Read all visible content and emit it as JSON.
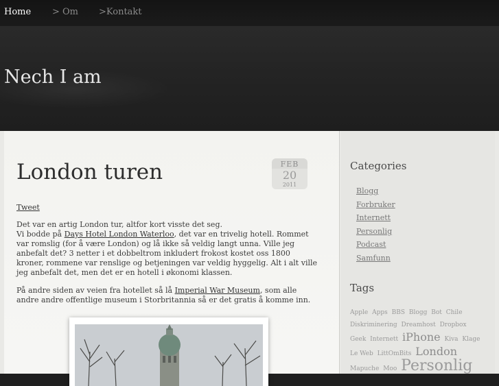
{
  "nav": {
    "home": "Home",
    "om": "> Om",
    "kontakt": ">Kontakt"
  },
  "header": {
    "site_title": "Nech I am"
  },
  "post": {
    "title": "London turen",
    "date": {
      "month": "FEB",
      "day": "20",
      "year": "2011"
    },
    "tweet_label": "Tweet",
    "p1_line1": "Det var en artig London tur, altfor kort visste det seg.",
    "p1_line2_pre": "Vi bodde på ",
    "p1_link": "Days Hotel London Waterloo",
    "p1_line2_post": ", det var en trivelig hotell. Rommet var romslig (for å være London) og lå ikke så veldig langt unna. Ville jeg anbefalt det? 3 netter i et dobbeltrom inkludert frokost kostet oss 1800 kroner, rommene var renslige og betjeningen var veldig hyggelig. Alt i alt ville jeg anbefalt det, men det er en hotell i økonomi klassen.",
    "p2_pre": "På andre siden av veien fra hotellet så lå ",
    "p2_link": "Imperial War Museum",
    "p2_post": ", som alle andre andre offentlige museum i Storbritannia så er det gratis å komme inn."
  },
  "sidebar": {
    "categories_heading": "Categories",
    "categories": [
      "Blogg",
      "Forbruker",
      "Internett",
      "Personlig",
      "Podcast",
      "Samfunn"
    ],
    "tags_heading": "Tags",
    "tags": [
      "Apple",
      "Apps",
      "BBS",
      "Blogg",
      "Bot",
      "Chile",
      "Diskriminering",
      "Dreamhost",
      "Dropbox",
      "Geek",
      "Internett",
      "iPhone",
      "Kiva",
      "Klage",
      "Le Web",
      "LittOmBits",
      "London",
      "Mapuche",
      "Moo",
      "Personlig"
    ]
  },
  "colors": {
    "nav_bg": "#141414",
    "header_bg": "#262626",
    "content_bg": "#f3f3f0",
    "sidebar_bg": "#e6e6e3"
  }
}
